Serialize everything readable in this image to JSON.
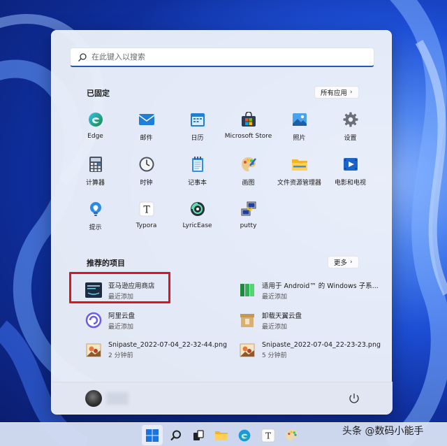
{
  "search": {
    "placeholder": "在此键入以搜索"
  },
  "pinned": {
    "title": "已固定",
    "all_apps_label": "所有应用",
    "apps": [
      {
        "label": "Edge",
        "icon": "edge-icon"
      },
      {
        "label": "邮件",
        "icon": "mail-icon"
      },
      {
        "label": "日历",
        "icon": "calendar-icon"
      },
      {
        "label": "Microsoft Store",
        "icon": "store-icon"
      },
      {
        "label": "照片",
        "icon": "photos-icon"
      },
      {
        "label": "设置",
        "icon": "settings-icon"
      },
      {
        "label": "计算器",
        "icon": "calculator-icon"
      },
      {
        "label": "时钟",
        "icon": "clock-icon"
      },
      {
        "label": "记事本",
        "icon": "notepad-icon"
      },
      {
        "label": "画图",
        "icon": "paint-icon"
      },
      {
        "label": "文件资源管理器",
        "icon": "file-explorer-icon"
      },
      {
        "label": "电影和电视",
        "icon": "movies-tv-icon"
      },
      {
        "label": "提示",
        "icon": "tips-icon"
      },
      {
        "label": "Typora",
        "icon": "typora-icon"
      },
      {
        "label": "LyricEase",
        "icon": "lyricease-icon"
      },
      {
        "label": "putty",
        "icon": "putty-icon"
      }
    ]
  },
  "recommended": {
    "title": "推荐的项目",
    "more_label": "更多",
    "items": [
      {
        "name": "亚马逊应用商店",
        "sub": "最近添加",
        "icon": "amazon-appstore-icon"
      },
      {
        "name": "适用于 Android™ 的 Windows 子系...",
        "sub": "最近添加",
        "icon": "wsa-icon"
      },
      {
        "name": "阿里云盘",
        "sub": "最近添加",
        "icon": "aliyun-drive-icon"
      },
      {
        "name": "卸载天翼云盘",
        "sub": "最近添加",
        "icon": "uninstall-tianyi-icon"
      },
      {
        "name": "Snipaste_2022-07-04_22-32-44.png",
        "sub": "2 分钟前",
        "icon": "image-file-icon"
      },
      {
        "name": "Snipaste_2022-07-04_22-23-23.png",
        "sub": "5 分钟前",
        "icon": "image-file-icon"
      }
    ]
  },
  "taskbar": {
    "icons": [
      "start-icon",
      "search-icon",
      "task-view-icon",
      "file-explorer-icon",
      "edge-icon",
      "typora-icon",
      "paint-icon"
    ]
  },
  "watermark": {
    "text": "头条 @数码小能手"
  },
  "colors": {
    "accent": "#1a5fb4",
    "highlight": "#e0141e"
  }
}
